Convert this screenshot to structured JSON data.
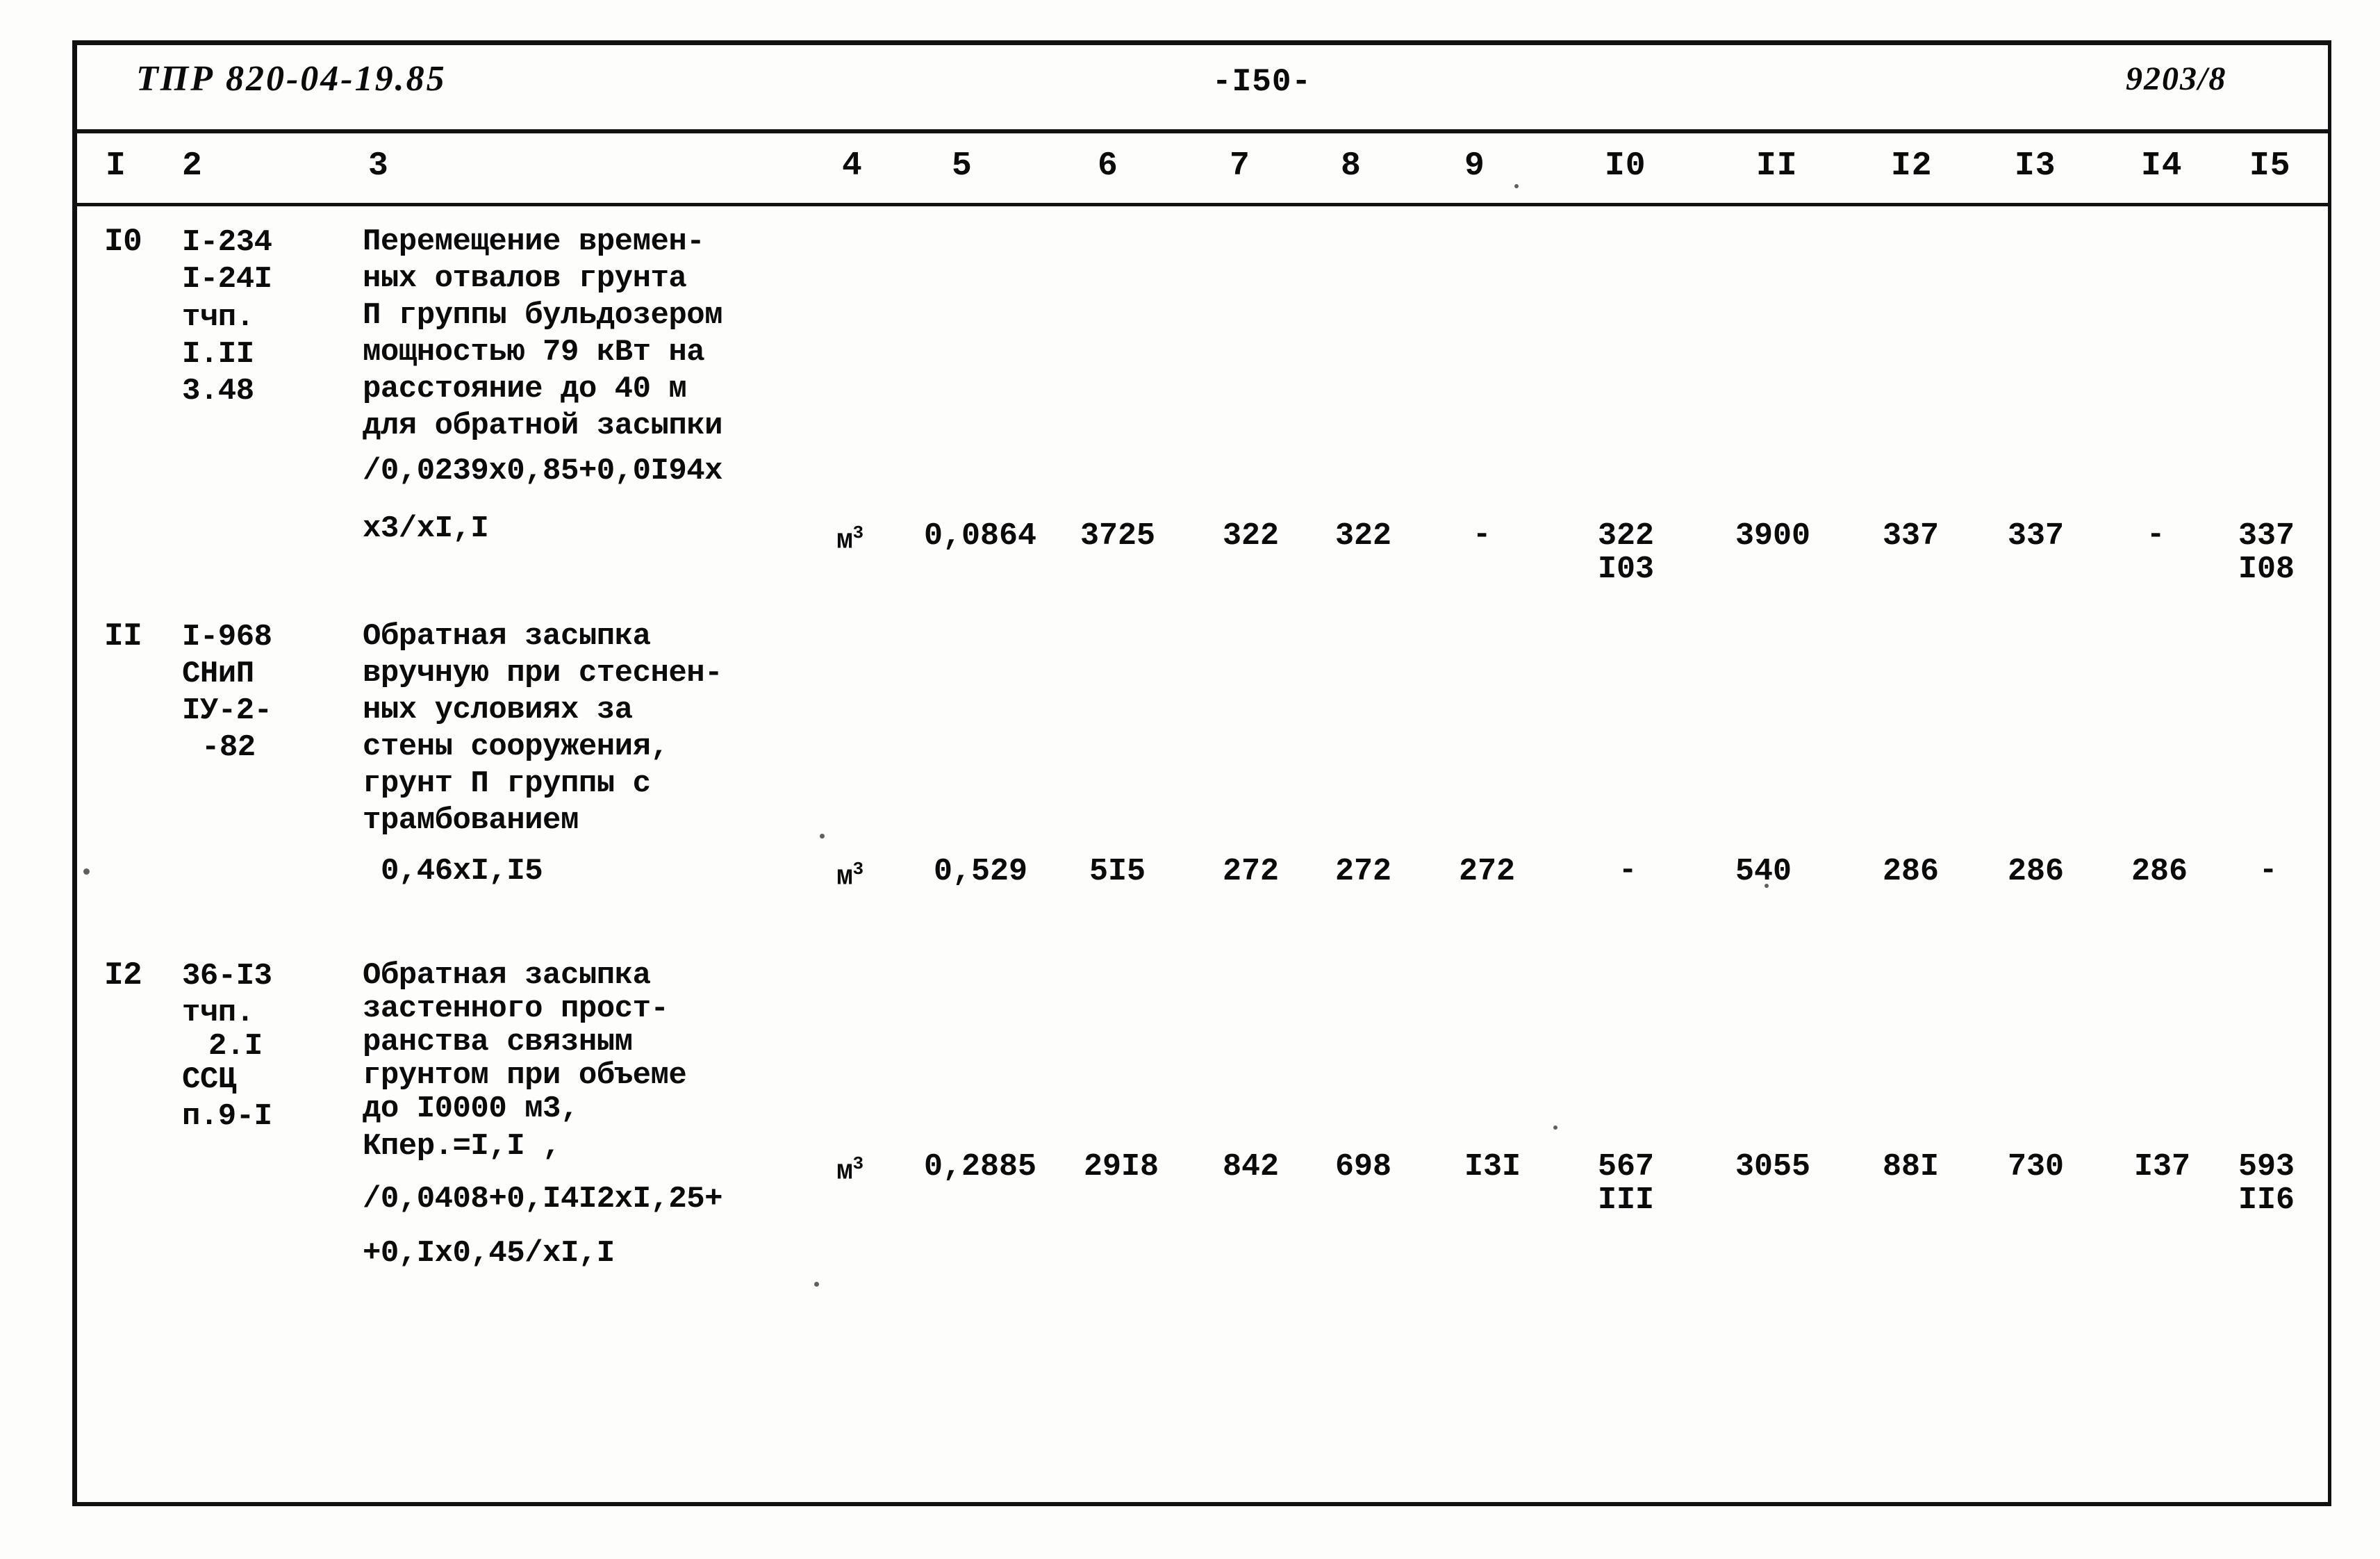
{
  "header": {
    "left": "ТПР 820-04-19.85",
    "center": "-I50-",
    "right": "9203/8"
  },
  "table": {
    "column_numbers": [
      "I",
      "2",
      "3",
      "4",
      "5",
      "6",
      "7",
      "8",
      "9",
      "I0",
      "II",
      "I2",
      "I3",
      "I4",
      "I5"
    ],
    "rows": [
      {
        "id": "I0",
        "code_lines": [
          "I-234",
          "I-24I",
          "тчп.",
          "I.II",
          "3.48"
        ],
        "description_lines": [
          "Перемещение времен-",
          "ных отвалов грунта",
          "П группы бульдозером",
          "мощностью 79 кВт на",
          "расстояние до 40 м",
          "для обратной засыпки"
        ],
        "formula_lines": [
          "/0,0239х0,85+0,0I94х",
          "х3/хI,I"
        ],
        "unit": "м",
        "unit_sup": "3",
        "c5": "0,0864",
        "c6": "3725",
        "c7": "322",
        "c8": "322",
        "c9": "-",
        "c10_top": "322",
        "c10_bottom": "I03",
        "c11": "3900",
        "c12": "337",
        "c13": "337",
        "c14": "-",
        "c15_top": "337",
        "c15_bottom": "I08"
      },
      {
        "id": "II",
        "code_lines": [
          "I-968",
          "СНиП",
          "IУ-2-",
          "-82"
        ],
        "description_lines": [
          "Обратная засыпка",
          "вручную при стеснен-",
          "ных условиях за",
          "стены сооружения,",
          "грунт П группы с",
          "трамбованием"
        ],
        "formula_lines": [
          "0,46хI,I5"
        ],
        "unit": "м",
        "unit_sup": "3",
        "c5": "0,529",
        "c6": "5I5",
        "c7": "272",
        "c8": "272",
        "c9": "272",
        "c10_top": "-",
        "c10_bottom": "",
        "c11": "540",
        "c12": "286",
        "c13": "286",
        "c14": "286",
        "c15_top": "-",
        "c15_bottom": ""
      },
      {
        "id": "I2",
        "code_lines": [
          "36-I3",
          "тчп.",
          "2.I",
          "ССЦ",
          "п.9-I"
        ],
        "description_lines": [
          "Обратная засыпка",
          "застенного прост-",
          "ранства связным",
          "грунтом при объеме",
          "до I0000 м3,",
          "Кпер.=I,I ,"
        ],
        "formula_lines": [
          "/0,0408+0,I4I2хI,25+",
          "+0,Iх0,45/хI,I"
        ],
        "unit": "м",
        "unit_sup": "3",
        "c5": "0,2885",
        "c6": "29I8",
        "c7": "842",
        "c8": "698",
        "c9": "I3I",
        "c10_top": "567",
        "c10_bottom": "III",
        "c11": "3055",
        "c12": "88I",
        "c13": "730",
        "c14": "I37",
        "c15_top": "593",
        "c15_bottom": "II6"
      }
    ]
  }
}
